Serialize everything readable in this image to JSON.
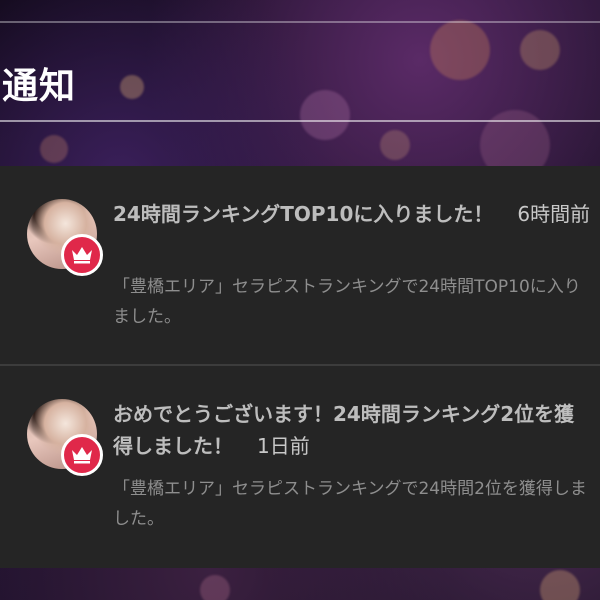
{
  "page": {
    "heading": "通知"
  },
  "notifications": [
    {
      "title": "24時間ランキングTOP10に入りました！",
      "time": "6時間前",
      "body": "「豊橋エリア」セラピストランキングで24時間TOP10に入りました。",
      "badge_icon": "crown-icon"
    },
    {
      "title": "おめでとうございます！24時間ランキング2位を獲得しました！",
      "time": "1日前",
      "body": "「豊橋エリア」セラピストランキングで24時間2位を獲得しました。",
      "badge_icon": "crown-icon"
    }
  ],
  "colors": {
    "badge": "#e0284a",
    "panel": "#252525",
    "title_text": "#bdbdbd",
    "body_text": "#8e8e8e"
  }
}
